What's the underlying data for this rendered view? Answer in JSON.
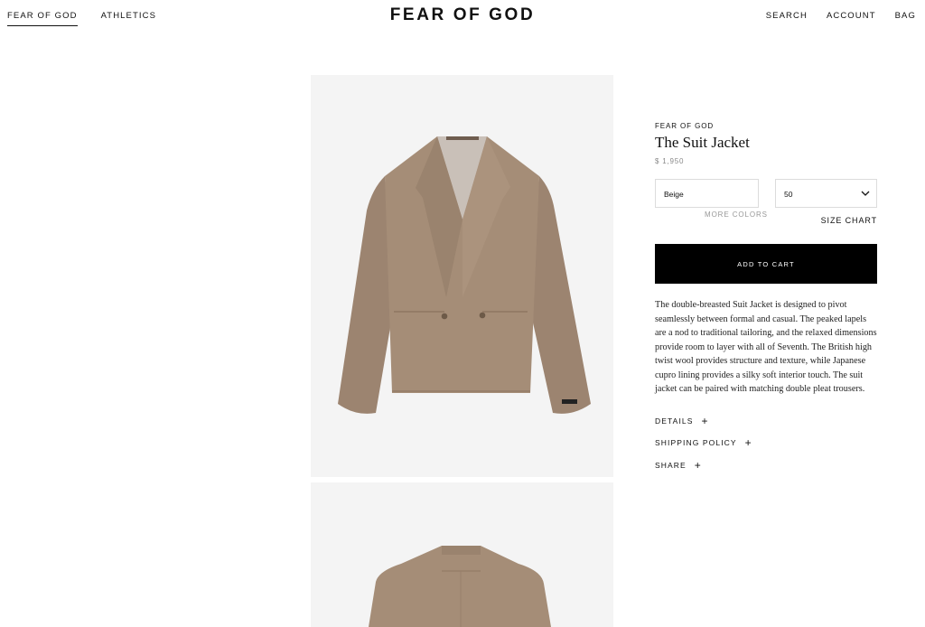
{
  "header": {
    "nav_left": [
      "FEAR OF GOD",
      "ATHLETICS"
    ],
    "logo": "FEAR OF GOD",
    "nav_right": [
      "SEARCH",
      "ACCOUNT",
      "BAG"
    ]
  },
  "product": {
    "brand": "FEAR OF GOD",
    "title": "The Suit Jacket",
    "price": "$ 1,950",
    "color_value": "Beige",
    "size_value": "50",
    "more_colors": "MORE COLORS",
    "size_chart": "SIZE CHART",
    "add_to_cart": "ADD TO CART",
    "description": "The double-breasted Suit Jacket is designed to pivot seamlessly between formal and casual. The peaked lapels are a nod to traditional tailoring, and the relaxed dimensions provide room to layer with all of Seventh. The British high twist wool provides structure and texture, while Japanese cupro lining provides a silky soft interior touch. The suit jacket can be paired with matching double pleat trousers.",
    "accordion": [
      "DETAILS",
      "SHIPPING POLICY",
      "SHARE"
    ],
    "accordion_icon": "+"
  },
  "colors": {
    "jacket": "#a58d77",
    "jacket_shadow": "#8f7762",
    "lining": "#c9c0b8",
    "panel_bg": "#f4f4f4",
    "button_bg": "#000000"
  }
}
